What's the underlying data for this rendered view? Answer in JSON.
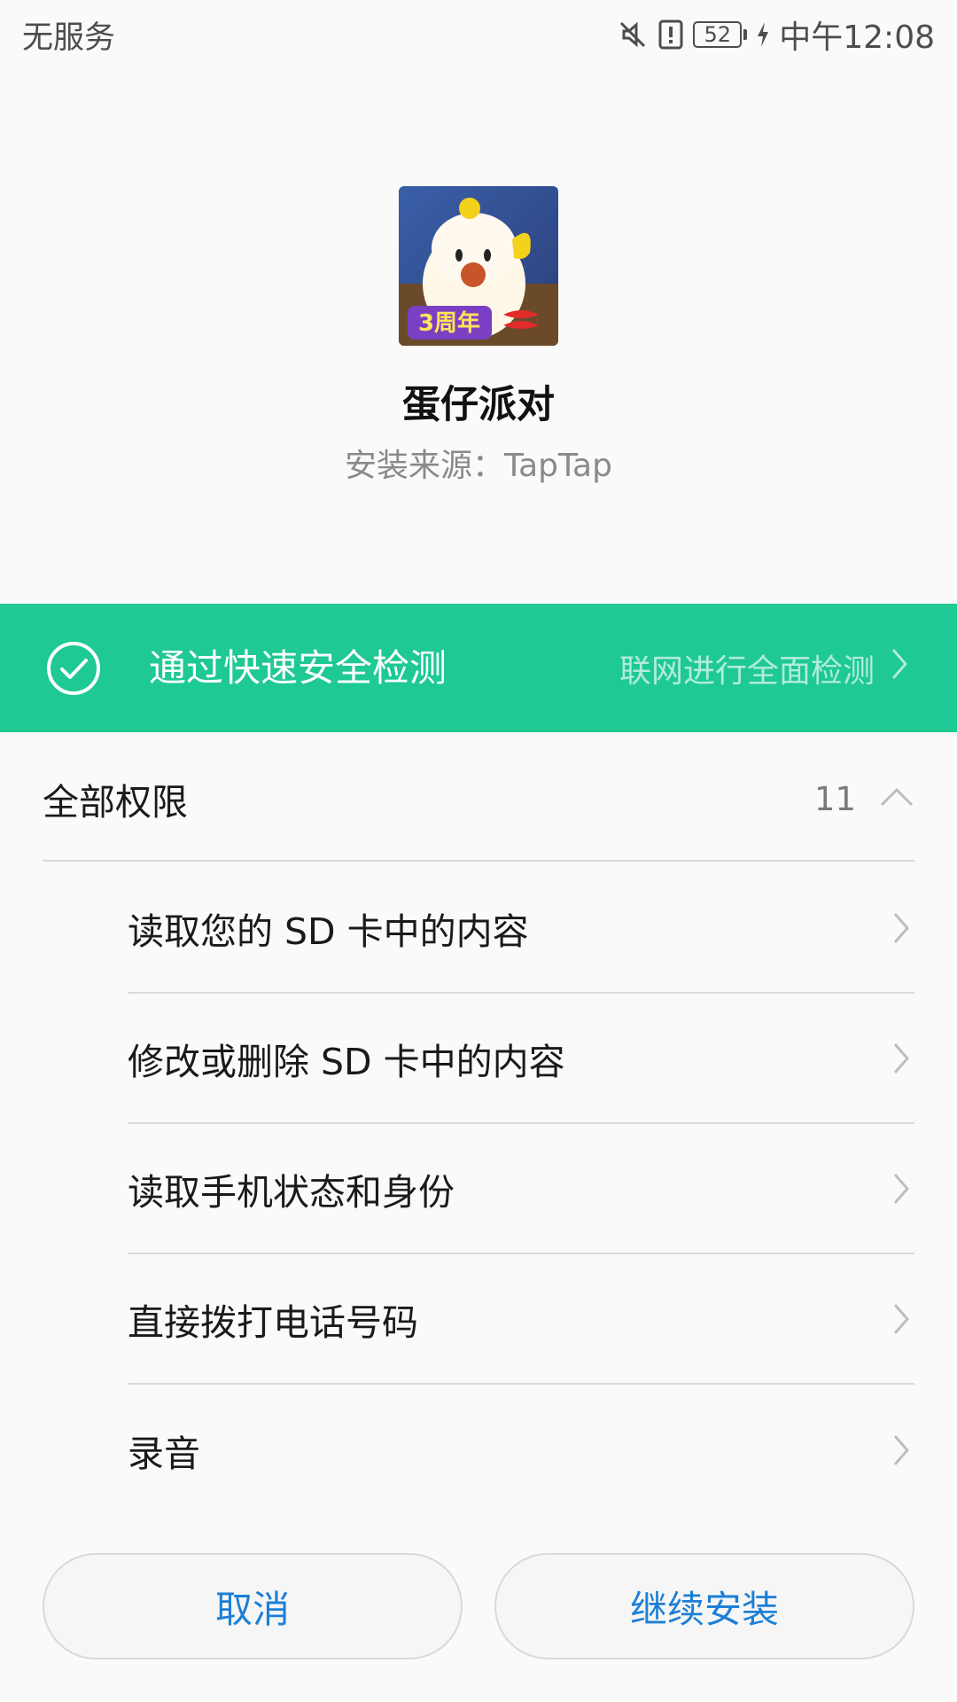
{
  "status_bar": {
    "carrier": "无服务",
    "battery": "52",
    "time": "中午12:08",
    "icons": [
      "mute-icon",
      "alert-icon",
      "battery-icon",
      "charging-icon"
    ]
  },
  "app": {
    "name": "蛋仔派对",
    "source": "安装来源：TapTap",
    "icon_badge": "3周年"
  },
  "security": {
    "title": "通过快速安全检测",
    "link": "联网进行全面检测",
    "color": "#1ec993"
  },
  "permissions": {
    "header": "全部权限",
    "count": "11",
    "items": [
      {
        "label": "读取您的 SD 卡中的内容"
      },
      {
        "label": "修改或删除 SD 卡中的内容"
      },
      {
        "label": "读取手机状态和身份"
      },
      {
        "label": "直接拨打电话号码"
      },
      {
        "label": "录音"
      }
    ]
  },
  "buttons": {
    "cancel": "取消",
    "continue": "继续安装",
    "accent": "#1c7fd6"
  }
}
